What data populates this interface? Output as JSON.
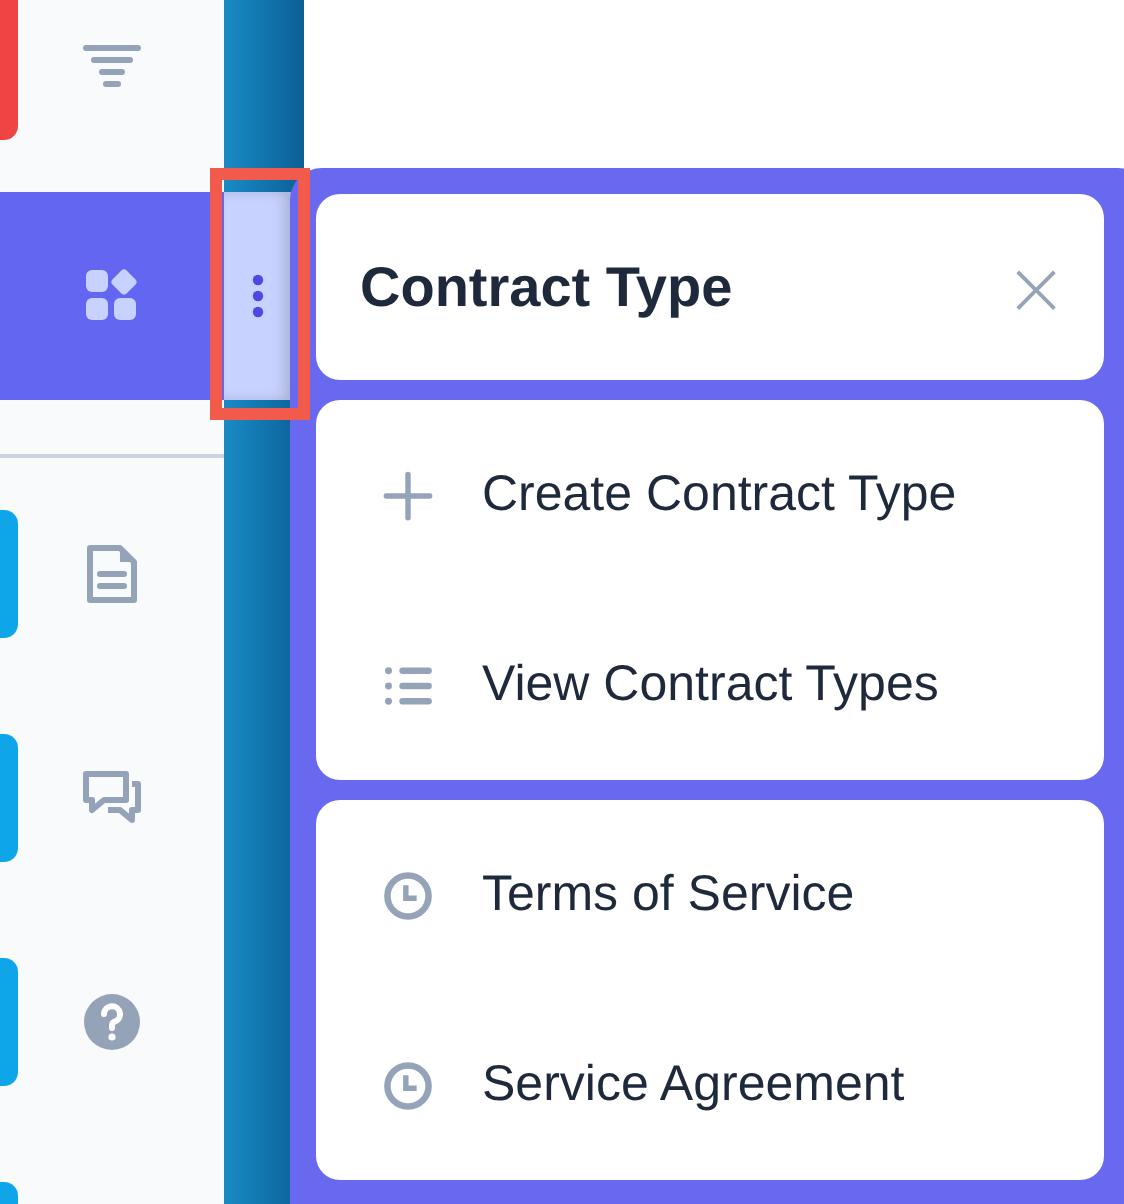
{
  "sidebar": {
    "items": [
      {
        "kind": "filter",
        "selected": false,
        "color": "#ef4444"
      },
      {
        "kind": "apps",
        "selected": true
      },
      {
        "kind": "divider"
      },
      {
        "kind": "document",
        "selected": false,
        "color": "#0ea5e9"
      },
      {
        "kind": "chat",
        "selected": false,
        "color": "#0ea5e9"
      },
      {
        "kind": "help",
        "selected": false,
        "color": "#0ea5e9"
      },
      {
        "kind": "blank",
        "selected": false,
        "color": "#0ea5e9"
      }
    ]
  },
  "handle": {
    "highlighted": true
  },
  "popover": {
    "title": "Contract Type",
    "close": "×",
    "sections": [
      {
        "items": [
          {
            "kind": "plus",
            "label": "Create Contract Type"
          },
          {
            "kind": "list",
            "label": "View Contract Types"
          }
        ]
      },
      {
        "items": [
          {
            "kind": "clock",
            "label": "Terms of Service"
          },
          {
            "kind": "clock",
            "label": "Service Agreement"
          }
        ]
      }
    ]
  }
}
